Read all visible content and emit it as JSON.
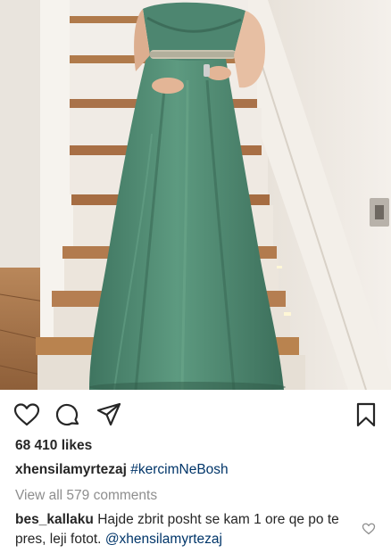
{
  "post": {
    "likes_text": "68 410 likes",
    "caption": {
      "username": "xhensilamyrtezaj",
      "hashtag": "#kercimNeBosh"
    },
    "view_all_comments": "View all 579 comments",
    "comment": {
      "username": "bes_kallaku",
      "text": "Hajde zbrit posht se kam 1 ore qe po te pres, leji fotot.",
      "mention": "@xhensilamyrtezaj"
    }
  },
  "icons": [
    "heart-icon",
    "comment-icon",
    "share-icon",
    "bookmark-icon",
    "small-heart-icon"
  ],
  "colors": {
    "dress": "#4f8a72",
    "text": "#262626",
    "muted": "#8e8e8e",
    "link": "#003569"
  }
}
